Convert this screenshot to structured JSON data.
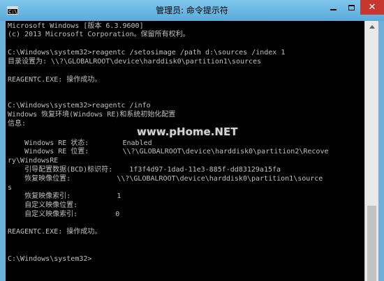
{
  "window": {
    "title": "管理员: 命令提示符",
    "icon": "C:\\",
    "close_glyph": "✕"
  },
  "console": {
    "lines": [
      "Microsoft Windows [版本 6.3.9600]",
      "(c) 2013 Microsoft Corporation。保留所有权利。",
      "",
      "C:\\Windows\\system32>reagentc /setosimage /path d:\\sources /index 1",
      "目录设置为: \\\\?\\GLOBALROOT\\device\\harddisk0\\partition1\\sources",
      "",
      "REAGENTC.EXE: 操作成功。",
      "",
      "C:\\Windows\\system32>reagentc /info",
      "Windows 恢复环境(Windows RE)和系统初始化配置",
      "信息:",
      "",
      "    Windows RE 状态:        Enabled",
      "    Windows RE 位置:        \\\\?\\GLOBALROOT\\device\\harddisk0\\partition2\\Recove",
      "ry\\WindowsRE",
      "    引导配置数据(BCD)标识符:    1f3f4d97-1dad-11e3-885f-dd83129a15fa",
      "    恢复映像位置:           \\\\?\\GLOBALROOT\\device\\harddisk0\\partition1\\source",
      "s",
      "    恢复映像索引:           1",
      "    自定义映像位置:",
      "    自定义映像索引:         0",
      "",
      "REAGENTC.EXE: 操作成功。",
      "",
      "",
      "C:\\Windows\\system32>"
    ]
  },
  "watermark": "www.pHome.NET"
}
